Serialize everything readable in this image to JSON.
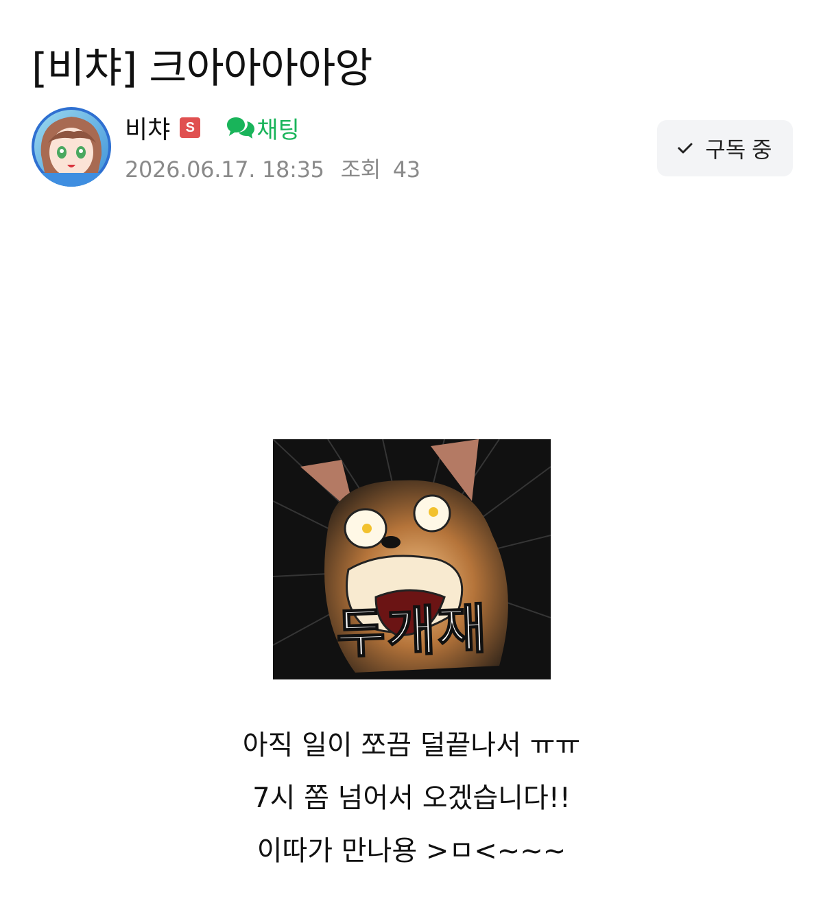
{
  "post": {
    "title": "[비챠] 크아아아아앙"
  },
  "author": {
    "name": "비챠",
    "badge_label": "S",
    "badge_color": "#e05050",
    "chat_label": "채팅",
    "chat_color": "#19b45a",
    "chat_icon": "chat-bubbles-icon",
    "avatar_icon": "anime-girl-avatar"
  },
  "meta": {
    "datetime": "2026.06.17. 18:35",
    "views_label": "조회",
    "views_count": "43"
  },
  "subscribe": {
    "label": "구독 중",
    "icon": "check-icon"
  },
  "image": {
    "caption": "두개재",
    "description_icon": "shocked-dog-meme"
  },
  "body": {
    "lines": [
      "아직 일이 쪼끔 덜끝나서 ㅠㅠ",
      "7시 쫌 넘어서 오겠습니다!!",
      "이따가 만나용 >ㅁ<~~~"
    ]
  }
}
